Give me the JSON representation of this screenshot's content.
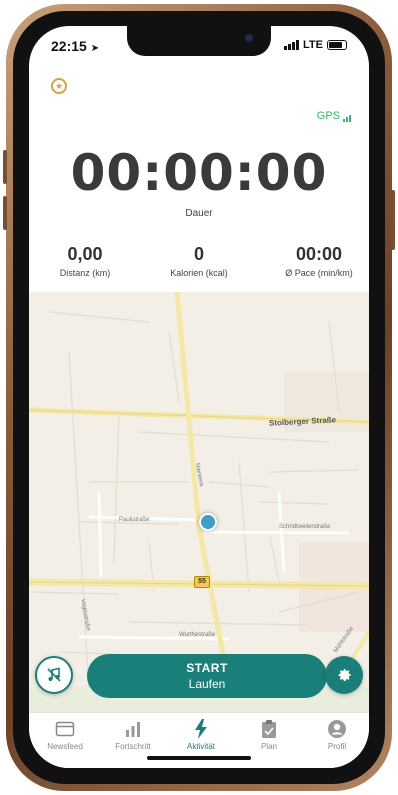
{
  "status_bar": {
    "time": "22:15",
    "network": "LTE"
  },
  "gps": {
    "label": "GPS"
  },
  "timer": {
    "value": "00:00:00",
    "label": "Dauer"
  },
  "stats": [
    {
      "value": "0,00",
      "label": "Distanz (km)"
    },
    {
      "value": "0",
      "label": "Kalorien (kcal)"
    },
    {
      "value": "00:00",
      "label": "Ø Pace (min/km)"
    }
  ],
  "map": {
    "streets": [
      "Stolberger Straße",
      "Paulistraße",
      "Schridtweilerstraße",
      "Wurthestraße",
      "Mühlstraße",
      "Vogtsstraße",
      "Nierwerk"
    ],
    "road_badge": "55"
  },
  "start_button": {
    "line1": "START",
    "line2": "Laufen"
  },
  "tabs": [
    {
      "label": "Newsfeed"
    },
    {
      "label": "Fortschritt"
    },
    {
      "label": "Aktivität"
    },
    {
      "label": "Plan"
    },
    {
      "label": "Profil"
    }
  ],
  "colors": {
    "accent": "#1a7f78",
    "gps": "#37b56a",
    "favorite": "#d6a04b"
  }
}
